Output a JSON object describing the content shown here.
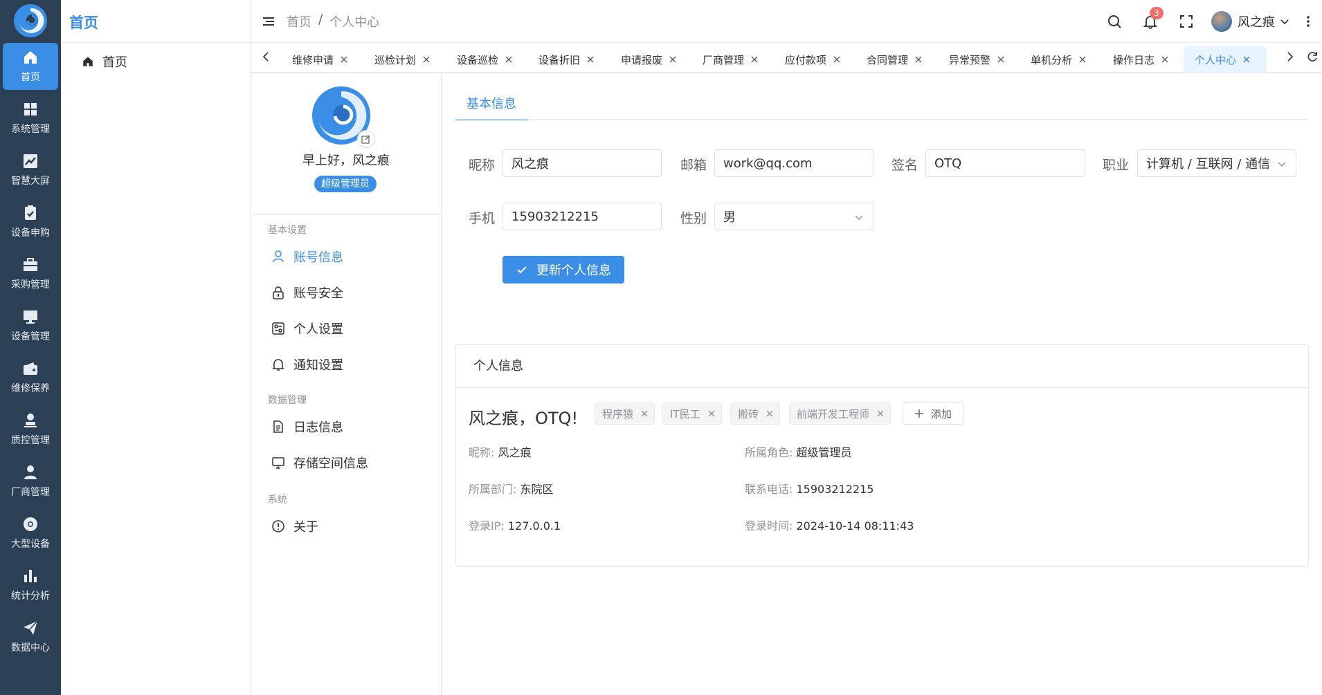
{
  "rail": {
    "items": [
      {
        "label": "首页",
        "icon": "home-icon"
      },
      {
        "label": "系统管理",
        "icon": "grid-icon"
      },
      {
        "label": "智慧大屏",
        "icon": "chart-line-icon"
      },
      {
        "label": "设备申购",
        "icon": "clipboard-check-icon"
      },
      {
        "label": "采购管理",
        "icon": "briefcase-icon"
      },
      {
        "label": "设备管理",
        "icon": "monitor-icon"
      },
      {
        "label": "维修保养",
        "icon": "wallet-icon"
      },
      {
        "label": "质控管理",
        "icon": "user-stamp-icon"
      },
      {
        "label": "厂商管理",
        "icon": "user-icon"
      },
      {
        "label": "大型设备",
        "icon": "chrome-icon"
      },
      {
        "label": "统计分析",
        "icon": "bar-chart-icon"
      },
      {
        "label": "数据中心",
        "icon": "paper-plane-icon"
      }
    ]
  },
  "submenu": {
    "title": "首页",
    "item": "首页"
  },
  "header": {
    "breadcrumb_home": "首页",
    "breadcrumb_sep": "/",
    "breadcrumb_current": "个人中心",
    "notification_count": "3",
    "username": "风之痕"
  },
  "tabs": [
    "维修申请",
    "巡检计划",
    "设备巡检",
    "设备折旧",
    "申请报废",
    "厂商管理",
    "应付款项",
    "合同管理",
    "异常预警",
    "单机分析",
    "操作日志",
    "个人中心"
  ],
  "profile": {
    "greeting": "早上好，风之痕",
    "role": "超级管理员"
  },
  "nav": {
    "group_basic": "基本设置",
    "account_info": "账号信息",
    "account_security": "账号安全",
    "personal_settings": "个人设置",
    "notification_settings": "通知设置",
    "group_data": "数据管理",
    "log_info": "日志信息",
    "storage_info": "存储空间信息",
    "group_system": "系统",
    "about": "关于"
  },
  "form": {
    "tab_label": "基本信息",
    "nickname_label": "昵称",
    "nickname_value": "风之痕",
    "email_label": "邮箱",
    "email_value": "work@qq.com",
    "signature_label": "签名",
    "signature_value": "OTQ",
    "job_label": "职业",
    "job_value": "计算机 / 互联网 / 通信",
    "phone_label": "手机",
    "phone_value": "15903212215",
    "gender_label": "性别",
    "gender_value": "男",
    "submit_label": "更新个人信息"
  },
  "card": {
    "title": "个人信息",
    "name_line": "风之痕，OTQ!",
    "tags": [
      "程序猿",
      "IT民工",
      "搬砖",
      "前端开发工程师"
    ],
    "add_label": "添加",
    "nickname_key": "昵称:",
    "nickname_val": "风之痕",
    "role_key": "所属角色:",
    "role_val": "超级管理员",
    "dept_key": "所属部门:",
    "dept_val": "东院区",
    "phone_key": "联系电话:",
    "phone_val": "15903212215",
    "ip_key": "登录IP:",
    "ip_val": "127.0.0.1",
    "time_key": "登录时间:",
    "time_val": "2024-10-14 08:11:43"
  },
  "colors": {
    "accent": "#3a8ee6",
    "rail": "#2b3f55",
    "badge": "#f56c6c"
  }
}
